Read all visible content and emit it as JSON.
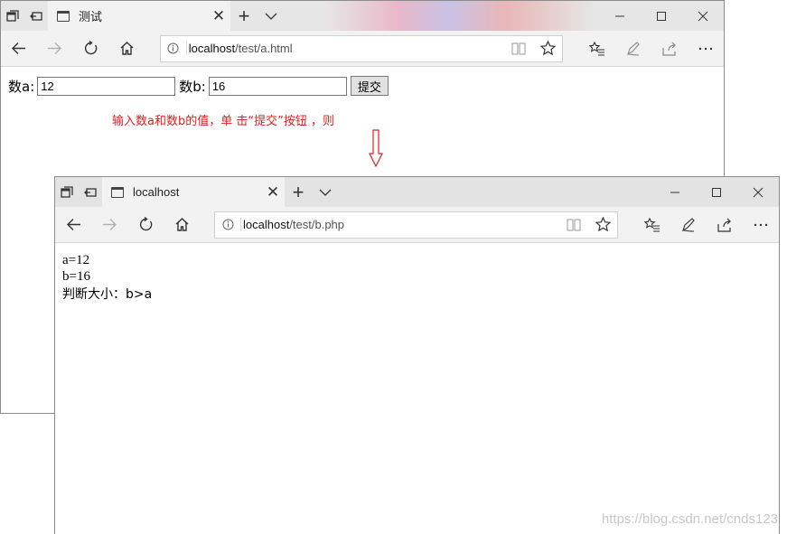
{
  "window1": {
    "tab_title": "测试",
    "url_host": "localhost",
    "url_path": "/test/a.html",
    "form": {
      "label_a": "数a:",
      "value_a": "12",
      "label_b": "数b:",
      "value_b": "16",
      "submit_label": "提交"
    }
  },
  "annotation": {
    "text": "输入数a和数b的值，单 击“提交”按钮 ，则",
    "color": "#e02020"
  },
  "window2": {
    "tab_title": "localhost",
    "url_host": "localhost",
    "url_path": "/test/b.php",
    "output": {
      "line_a": "a=12",
      "line_b": "b=16",
      "line_judge": "判断大小：b>a"
    }
  },
  "watermark": "https://blog.csdn.net/cnds123",
  "icons": [
    "tab-actions-icon",
    "set-aside-icon",
    "page-icon",
    "close-icon",
    "new-tab-icon",
    "chevron-down-icon",
    "minimize-icon",
    "maximize-icon",
    "back-icon",
    "forward-icon",
    "refresh-icon",
    "home-icon",
    "info-icon",
    "reading-view-icon",
    "star-icon",
    "favorites-icon",
    "pen-icon",
    "share-icon",
    "more-icon",
    "down-arrow-icon"
  ]
}
